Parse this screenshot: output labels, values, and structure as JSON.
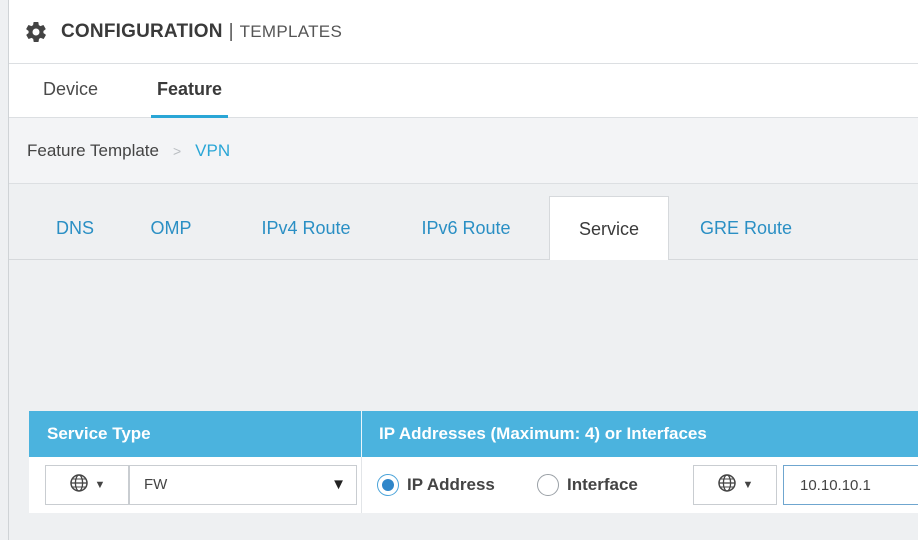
{
  "header": {
    "title_main": "CONFIGURATION",
    "title_sep": "|",
    "title_sub": "TEMPLATES",
    "icon": "gear-icon"
  },
  "top_tabs": [
    {
      "label": "Device",
      "active": false
    },
    {
      "label": "Feature",
      "active": true
    }
  ],
  "breadcrumb": {
    "root": "Feature Template",
    "separator": ">",
    "current": "VPN"
  },
  "sub_tabs": [
    {
      "label": "DNS",
      "active": false
    },
    {
      "label": "OMP",
      "active": false
    },
    {
      "label": "IPv4 Route",
      "active": false
    },
    {
      "label": "IPv6 Route",
      "active": false
    },
    {
      "label": "Service",
      "active": true
    },
    {
      "label": "GRE Route",
      "active": false
    }
  ],
  "service_table": {
    "columns": [
      "Service Type",
      "IP Addresses (Maximum: 4) or Interfaces"
    ],
    "row": {
      "scope_icon": "globe-icon",
      "service_type_value": "FW",
      "radio_ip_label": "IP Address",
      "radio_ip_selected": true,
      "radio_interface_label": "Interface",
      "radio_interface_selected": false,
      "ip_scope_icon": "globe-icon",
      "ip_value": "10.10.10.1"
    }
  },
  "colors": {
    "accent": "#2aa6d6",
    "table_header": "#4bb3de",
    "link": "#2a8fc4"
  }
}
